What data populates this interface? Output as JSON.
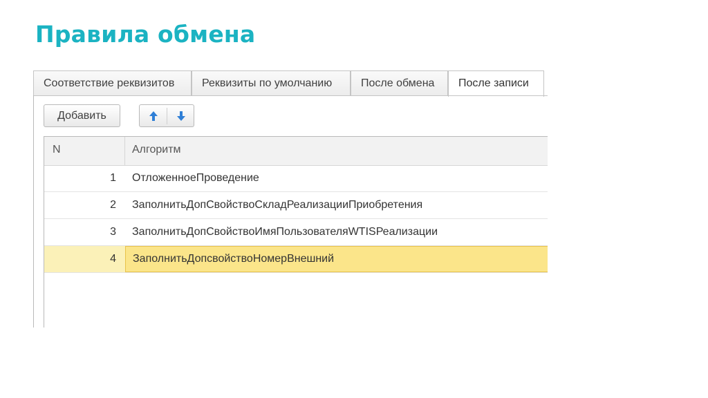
{
  "slide": {
    "title": "Правила обмена"
  },
  "tabs": [
    {
      "label": "Соответствие реквизитов"
    },
    {
      "label": "Реквизиты по умолчанию"
    },
    {
      "label": "После обмена"
    },
    {
      "label": "После записи"
    }
  ],
  "toolbar": {
    "add_label": "Добавить",
    "move_up_icon": "arrow-up-icon",
    "move_down_icon": "arrow-down-icon"
  },
  "table": {
    "columns": [
      "N",
      "Алгоритм"
    ],
    "rows": [
      {
        "n": "1",
        "algorithm": "ОтложенноеПроведение"
      },
      {
        "n": "2",
        "algorithm": "ЗаполнитьДопСвойствоСкладРеализацииПриобретения"
      },
      {
        "n": "3",
        "algorithm": "ЗаполнитьДопСвойствоИмяПользователяWTISРеализации"
      },
      {
        "n": "4",
        "algorithm": "ЗаполнитьДопсвойствоНомерВнешний"
      }
    ],
    "selected_row": 4
  },
  "colors": {
    "title": "#1bb3c2",
    "selection": "#fbe58a",
    "arrow": "#2f7fd6"
  }
}
